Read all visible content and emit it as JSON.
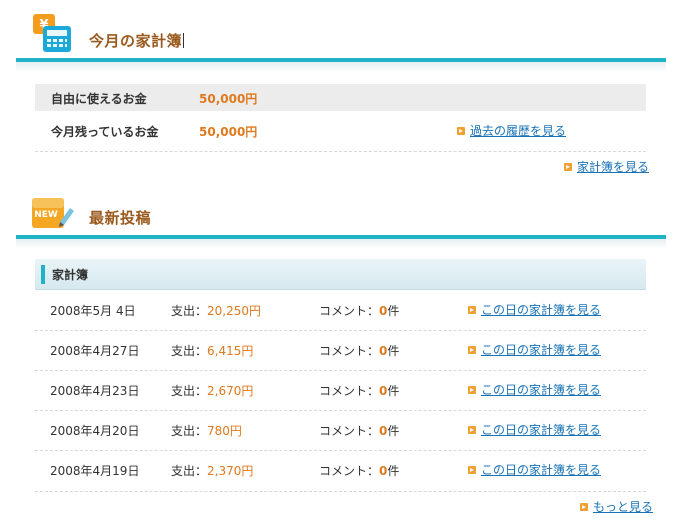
{
  "budget": {
    "title": "今月の家計簿",
    "rows": [
      {
        "label": "自由に使えるお金",
        "amount": "50,000円"
      },
      {
        "label": "今月残っているお金",
        "amount": "50,000円"
      }
    ],
    "history_link": "過去の履歴を見る",
    "view_link": "家計簿を見る"
  },
  "latest": {
    "title": "最新投稿",
    "badge": "NEW",
    "subheading": "家計簿",
    "expense_label": "支出：",
    "comment_label": "コメント：",
    "comment_unit": "件",
    "entries": [
      {
        "date": "2008年5月 4日",
        "expense": "20,250円",
        "comments": "0",
        "link": "この日の家計簿を見る"
      },
      {
        "date": "2008年4月27日",
        "expense": "6,415円",
        "comments": "0",
        "link": "この日の家計簿を見る"
      },
      {
        "date": "2008年4月23日",
        "expense": "2,670円",
        "comments": "0",
        "link": "この日の家計簿を見る"
      },
      {
        "date": "2008年4月20日",
        "expense": "780円",
        "comments": "0",
        "link": "この日の家計簿を見る"
      },
      {
        "date": "2008年4月19日",
        "expense": "2,370円",
        "comments": "0",
        "link": "この日の家計簿を見る"
      }
    ],
    "more_link": "もっと見る"
  },
  "colors": {
    "accent": "#20b3c8",
    "amount": "#e07a1e",
    "title": "#9a5a1e",
    "link": "#1a73b8"
  },
  "icons": {
    "budget": "yen-calculator-icon",
    "latest": "new-pencil-icon",
    "bullet": "orange-arrow-bullet-icon"
  }
}
